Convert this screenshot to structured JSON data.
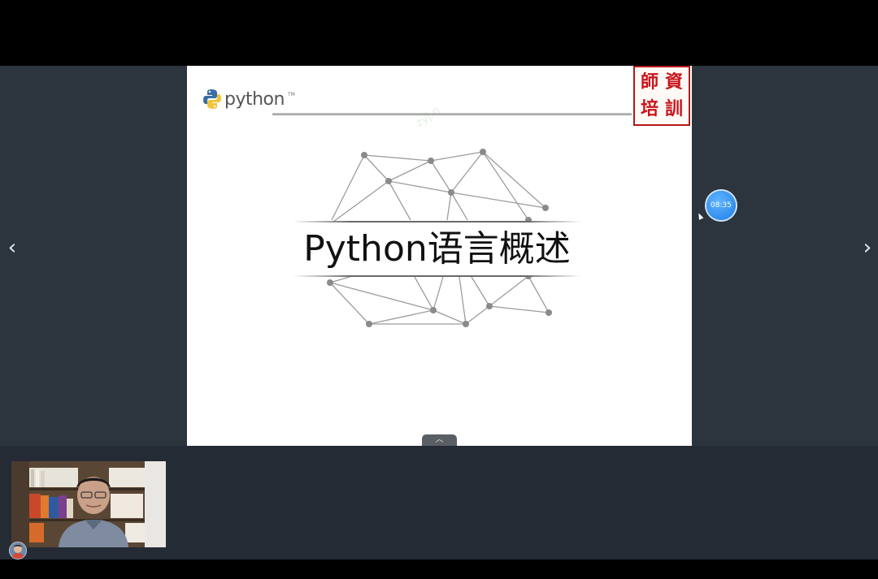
{
  "navigation": {
    "prev_icon": "chevron-left-icon",
    "next_icon": "chevron-right-icon",
    "prev_glyph": "‹",
    "next_glyph": "›"
  },
  "slide": {
    "logo_text": "python",
    "logo_tm": "TM",
    "title": "Python语言概述",
    "watermark": "zyj.n",
    "seal_chars": [
      "師",
      "資",
      "培",
      "訓"
    ]
  },
  "timer": {
    "time": "08:35"
  },
  "expand_tab": {
    "icon": "chevron-up-icon",
    "glyph": "︿"
  },
  "colors": {
    "stage_bg": "#2c343d",
    "panel_bg": "#252b35",
    "seal_red": "#c8141a",
    "timer_blue": "#1f7fe6"
  }
}
